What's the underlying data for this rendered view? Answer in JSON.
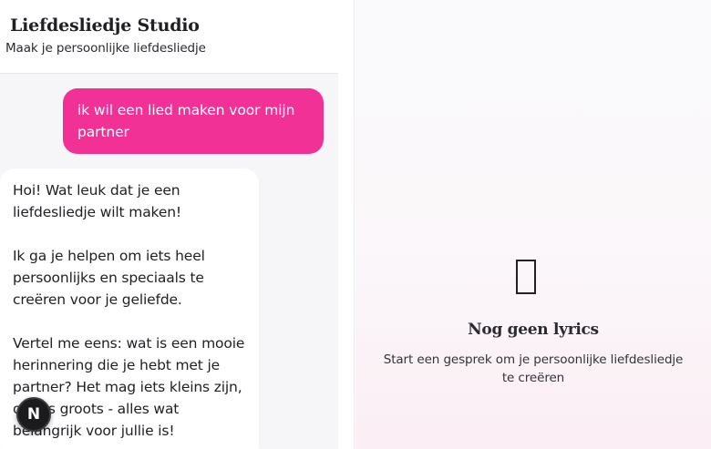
{
  "header": {
    "logo_glyph": "",
    "title": "Liefdesliedje Studio",
    "subtitle": "Maak je persoonlijke liefdesliedje"
  },
  "messages": {
    "user_1": "ik wil een lied maken voor mijn partner",
    "bot_1": {
      "para_1": "Hoi! Wat leuk dat je een liefdesliedje wilt maken! ",
      "para_2": "Ik ga je helpen om iets heel persoonlijks en speciaals te creëren voor je geliefde.",
      "para_3": "Vertel me eens: wat is een mooie herinnering die je hebt met je partner? Het mag iets kleins zijn, of iets groots - alles wat belangrijk voor jullie is!"
    }
  },
  "badge": {
    "letter": "N"
  },
  "lyrics": {
    "empty_icon": "music-note-icon",
    "empty_title": "Nog geen lyrics",
    "empty_description": "Start een gesprek om je persoonlijke liefdesliedje te creëren"
  },
  "colors": {
    "accent": "#f23196",
    "chat_bg": "#f6f6f8",
    "badge_bg": "#1b1b1d"
  }
}
